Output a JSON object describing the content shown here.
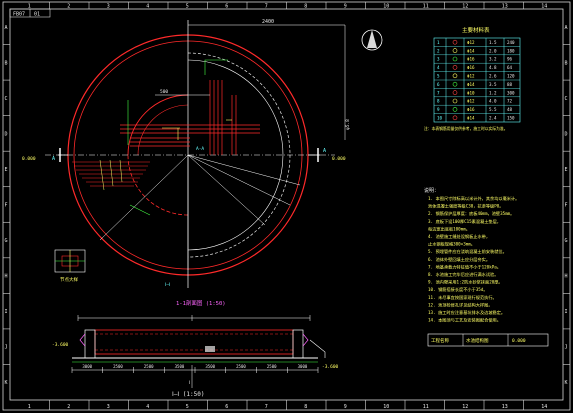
{
  "title_block": {
    "code": "FB07",
    "rev": "01"
  },
  "border": {
    "top_numbers": [
      "1",
      "2",
      "3",
      "4",
      "5",
      "6",
      "7",
      "8",
      "9",
      "10",
      "11",
      "12",
      "13",
      "14"
    ],
    "bottom_numbers": [
      "1",
      "2",
      "3",
      "4",
      "5",
      "6",
      "7",
      "8",
      "9",
      "10",
      "11",
      "12",
      "13",
      "14"
    ],
    "left_letters": [
      "A",
      "B",
      "C",
      "D",
      "E",
      "F",
      "G",
      "H",
      "I",
      "J",
      "K"
    ],
    "right_letters": [
      "A",
      "B",
      "C",
      "D",
      "E",
      "F",
      "G",
      "H",
      "I",
      "J",
      "K"
    ]
  },
  "plan": {
    "dim_top": "2400",
    "dim_left": "500",
    "dim_side": "φ5.8",
    "elev_right": "0.000",
    "elev_left": "0.000",
    "section_mark_left": "A",
    "section_mark_right": "A",
    "note_bottom_center": "Ⅰ—Ⅰ",
    "small_label": "A-A"
  },
  "detail_caption": "节点大样",
  "section_title": "1-1剖面图 (1:50)",
  "section_title_bottom": "Ⅰ—Ⅰ (1:50)",
  "legend": {
    "header": "主要材料表",
    "rows": [
      {
        "no": "1",
        "spec": "Φ12",
        "len": "1.5",
        "qty": "240"
      },
      {
        "no": "2",
        "spec": "Φ14",
        "len": "2.0",
        "qty": "180"
      },
      {
        "no": "3",
        "spec": "Φ16",
        "len": "3.2",
        "qty": "96"
      },
      {
        "no": "4",
        "spec": "Φ16",
        "len": "4.8",
        "qty": "64"
      },
      {
        "no": "5",
        "spec": "Φ12",
        "len": "2.6",
        "qty": "120"
      },
      {
        "no": "6",
        "spec": "Φ14",
        "len": "3.5",
        "qty": "88"
      },
      {
        "no": "7",
        "spec": "Φ10",
        "len": "1.2",
        "qty": "300"
      },
      {
        "no": "8",
        "spec": "Φ12",
        "len": "4.0",
        "qty": "72"
      },
      {
        "no": "9",
        "spec": "Φ16",
        "len": "5.5",
        "qty": "48"
      },
      {
        "no": "10",
        "spec": "Φ14",
        "len": "2.4",
        "qty": "150"
      }
    ],
    "footnote": "注：本表钢筋用量仅供参考，施工时以实际为准。"
  },
  "notes": {
    "heading": "说明：",
    "lines": [
      "1. 本图尺寸除标高以米计外，其余均以毫米计。",
      "   池体混凝土强度等级C30，抗渗等级P8。",
      "2. 钢筋保护层厚度：底板40mm，池壁35mm。",
      "3. 底板下设100厚C15素混凝土垫层，",
      "   每边宽出底板100mm。",
      "4. 池壁施工缝处设钢板止水带，",
      "   止水钢板规格300×3mm。",
      "5. 预埋管件应在浇筑混凝土前安装就位。",
      "6. 池体外壁回填土应分层夯实。",
      "7. 地基承载力特征值不小于120kPa。",
      "8. 水池施工完毕后应进行满水试验。",
      "9. 池内壁采用1:2防水砂浆抹面20厚。",
      "10. 钢筋搭接长度不小于35d。",
      "11. 未尽事宜按国家现行规范执行。",
      "12. 池顶检修孔详见结构大样图。",
      "13. 施工时应注意基坑排水及边坡稳定。",
      "14. 本图须与工艺及安装图配合使用。"
    ],
    "box_left": "工程名称",
    "box_mid": "水池结构图",
    "box_right": "0.000"
  },
  "section": {
    "dims": [
      "3000",
      "2500",
      "2500",
      "3500",
      "3500",
      "2500",
      "2500",
      "3000"
    ],
    "center_mark": "Ⅰ",
    "elev_left": "-3.600",
    "elev_right": "-3.600"
  }
}
